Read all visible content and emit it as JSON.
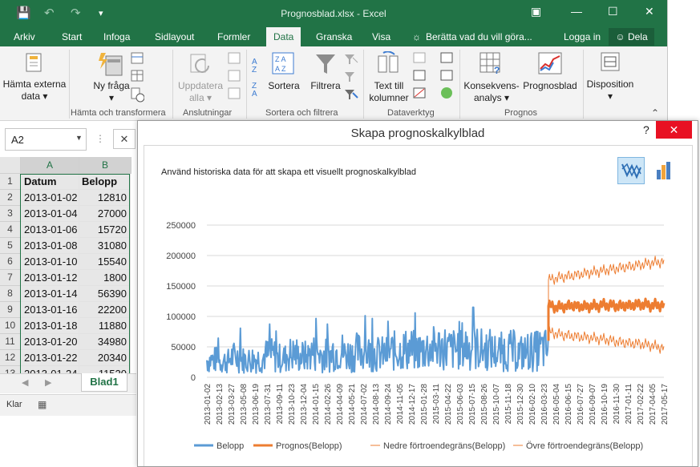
{
  "window": {
    "title": "Prognosblad.xlsx - Excel",
    "tabs": [
      "Arkiv",
      "Start",
      "Infoga",
      "Sidlayout",
      "Formler",
      "Data",
      "Granska",
      "Visa"
    ],
    "active_tab": "Data",
    "tell_me": "Berätta vad du vill göra...",
    "login": "Logga in",
    "share": "Dela"
  },
  "ribbon": {
    "get_external": "Hämta externa data",
    "new_query": "Ny fråga",
    "refresh_all": "Uppdatera alla",
    "sort": "Sortera",
    "filter": "Filtrera",
    "text_to_columns": "Text till kolumner",
    "whatif": "Konsekvens- analys",
    "forecast": "Prognosblad",
    "outline": "Disposition",
    "groups": [
      "Hämta och transformera",
      "Anslutningar",
      "Sortera och filtrera",
      "Dataverktyg",
      "Prognos"
    ]
  },
  "namebox": "A2",
  "sheet": {
    "col_headers": [
      "A",
      "B"
    ],
    "header_row": [
      "Datum",
      "Belopp"
    ],
    "rows": [
      [
        "2013-01-02",
        "12810"
      ],
      [
        "2013-01-04",
        "27000"
      ],
      [
        "2013-01-06",
        "15720"
      ],
      [
        "2013-01-08",
        "31080"
      ],
      [
        "2013-01-10",
        "15540"
      ],
      [
        "2013-01-12",
        "1800"
      ],
      [
        "2013-01-14",
        "56390"
      ],
      [
        "2013-01-16",
        "22200"
      ],
      [
        "2013-01-18",
        "11880"
      ],
      [
        "2013-01-20",
        "34980"
      ],
      [
        "2013-01-22",
        "20340"
      ],
      [
        "2013-01-24",
        "11520"
      ]
    ],
    "row_numbers": [
      "1",
      "2",
      "3",
      "4",
      "5",
      "6",
      "7",
      "8",
      "9",
      "10",
      "11",
      "12",
      "13"
    ],
    "tab": "Blad1",
    "status": "Klar"
  },
  "dialog": {
    "title": "Skapa prognoskalkylblad",
    "help": "?",
    "close": "✕",
    "description": "Använd historiska data för att skapa ett visuellt prognoskalkylblad"
  },
  "chart_data": {
    "type": "line",
    "ylim": [
      0,
      250000
    ],
    "yticks": [
      0,
      50000,
      100000,
      150000,
      200000,
      250000
    ],
    "ytick_labels": [
      "0",
      "50000",
      "100000",
      "150000",
      "200000",
      "250000"
    ],
    "xtick_labels": [
      "2013-01-02",
      "2013-02-13",
      "2013-03-27",
      "2013-05-08",
      "2013-06-19",
      "2013-07-31",
      "2013-09-11",
      "2013-10-23",
      "2013-12-04",
      "2014-01-15",
      "2014-02-26",
      "2014-04-09",
      "2014-05-21",
      "2014-07-02",
      "2014-08-13",
      "2014-09-24",
      "2014-11-05",
      "2014-12-17",
      "2015-01-28",
      "2015-03-11",
      "2015-04-22",
      "2015-06-03",
      "2015-07-15",
      "2015-08-26",
      "2015-10-07",
      "2015-11-18",
      "2015-12-30",
      "2016-02-10",
      "2016-03-23",
      "2016-05-04",
      "2016-06-15",
      "2016-07-27",
      "2016-09-07",
      "2016-10-19",
      "2016-11-30",
      "2017-01-11",
      "2017-02-22",
      "2017-04-05",
      "2017-05-17"
    ],
    "grid": "horizontal",
    "legend_position": "bottom",
    "series": [
      {
        "name": "Belopp",
        "color": "#5b9bd5",
        "approx_values": [
          30000,
          28000,
          35000,
          30000,
          32000,
          38000,
          33000,
          40000,
          36000,
          42000,
          38000,
          45000,
          40000,
          44000,
          42000,
          40000,
          45000,
          48000,
          46000,
          50000,
          52000,
          48000,
          55000,
          50000,
          48000,
          44000,
          46000,
          42000,
          45000,
          48000
        ],
        "notes_range": [
          5000,
          123000
        ]
      },
      {
        "name": "Prognos(Belopp)",
        "color": "#ed7d31",
        "values": [
          117000,
          115000,
          118000,
          116000,
          117000,
          119000,
          117000,
          118000,
          120000,
          118000,
          119000
        ]
      },
      {
        "name": "Nedre förtroendegräns(Belopp)",
        "color": "#ed7d31",
        "values": [
          75000,
          70000,
          68000,
          66000,
          64000,
          62000,
          58000,
          56000,
          55000,
          52000,
          48000
        ]
      },
      {
        "name": "Övre förtroendegräns(Belopp)",
        "color": "#ed7d31",
        "values": [
          160000,
          164000,
          167000,
          170000,
          173000,
          176000,
          179000,
          182000,
          185000,
          188000,
          190000
        ]
      }
    ]
  }
}
